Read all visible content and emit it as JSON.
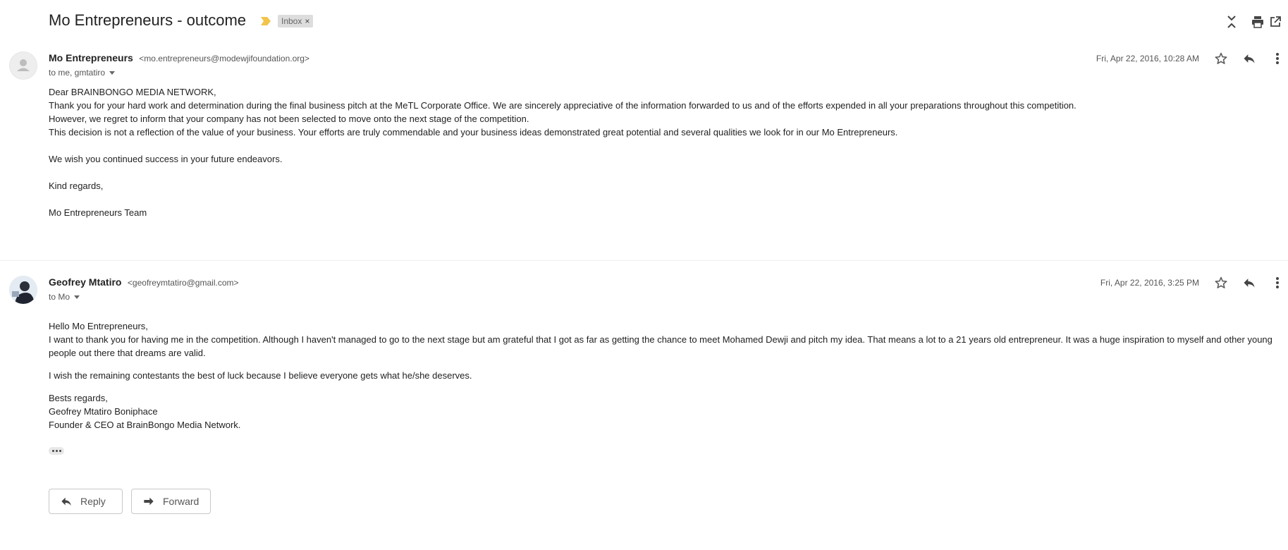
{
  "thread": {
    "subject": "Mo Entrepreneurs - outcome",
    "label": "Inbox",
    "label_close": "×",
    "importance_color": "#f2c44a"
  },
  "header_icons": [
    "collapse-all-icon",
    "print-icon",
    "open-in-new-window-icon"
  ],
  "messages": [
    {
      "sender_name": "Mo Entrepreneurs",
      "sender_email": "<mo.entrepreneurs@modewjifoundation.org>",
      "recipients": "to me, gmtatiro",
      "date": "Fri, Apr 22, 2016, 10:28 AM",
      "body": [
        "Dear BRAINBONGO MEDIA NETWORK,",
        "Thank you for your hard work and determination during the final business pitch at the MeTL Corporate Office. We are sincerely appreciative of the information forwarded to us and of the efforts expended in all your preparations throughout this competition.",
        "However, we regret to inform that your company has not been selected to move onto the next stage of the competition.",
        "This decision is not a reflection of the value of your business. Your efforts are truly commendable and your business ideas demonstrated great potential and several qualities we look for in our Mo Entrepreneurs.",
        "We wish you continued success in your future endeavors.",
        "Kind regards,",
        "Mo Entrepreneurs Team"
      ]
    },
    {
      "sender_name": "Geofrey Mtatiro",
      "sender_email": "<geofreymtatiro@gmail.com>",
      "recipients": "to Mo",
      "date": "Fri, Apr 22, 2016, 3:25 PM",
      "body": [
        "Hello Mo Entrepreneurs,",
        "I want to thank you for having me in the competition. Although I haven't managed to go to the next stage but am grateful that I got as far as getting the chance to meet Mohamed Dewji and pitch my idea. That means a lot to a 21 years old entrepreneur. It was a huge inspiration to myself and other young people out there that dreams are valid.",
        "I wish the remaining contestants the best of luck because I believe everyone gets what he/she deserves.",
        "Bests regards,",
        "Geofrey Mtatiro Boniphace",
        "Founder & CEO at BrainBongo Media Network."
      ]
    }
  ],
  "actions": {
    "reply_label": "Reply",
    "forward_label": "Forward"
  }
}
